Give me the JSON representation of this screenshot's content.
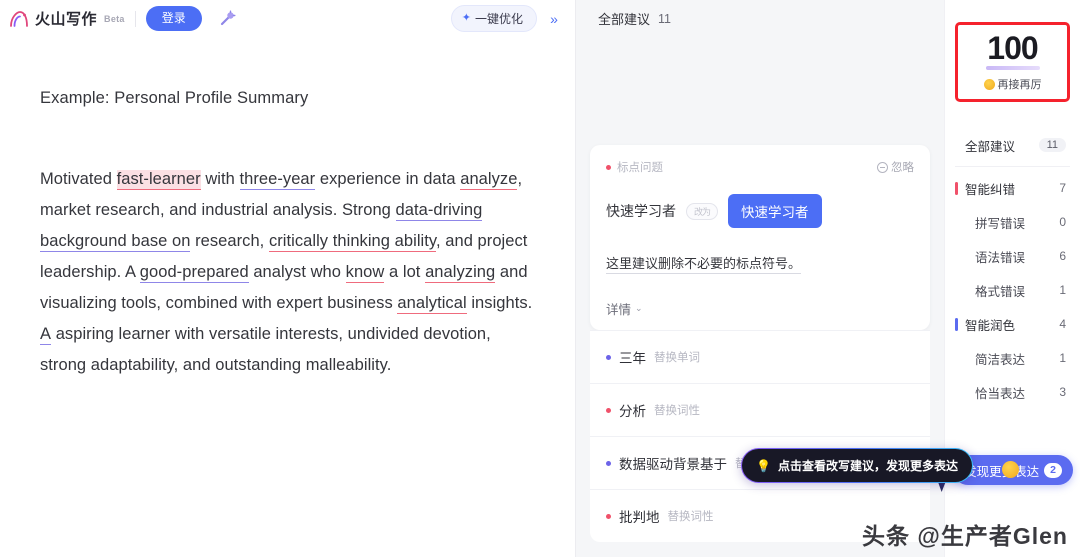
{
  "header": {
    "brand_name": "火山写作",
    "beta_tag": "Beta",
    "login_label": "登录",
    "magic_icon": "magic-wand-icon",
    "optimize_label": "一键优化",
    "sparkle_icon": "sparkle-icon",
    "collapse_icon": "»"
  },
  "document": {
    "title": "Example: Personal Profile Summary",
    "paragraph_segments": [
      {
        "text": "Motivated ",
        "style": "plain"
      },
      {
        "text": "fast-learner",
        "style": "highlight-red"
      },
      {
        "text": " with ",
        "style": "plain"
      },
      {
        "text": "three-year",
        "style": "underline-purple"
      },
      {
        "text": " experience in data ",
        "style": "plain"
      },
      {
        "text": "analyze",
        "style": "underline-red"
      },
      {
        "text": ", market research, and industrial analysis. Strong ",
        "style": "plain"
      },
      {
        "text": "data-driving background base on",
        "style": "underline-purple"
      },
      {
        "text": " research, ",
        "style": "plain"
      },
      {
        "text": "critically thinking ability",
        "style": "underline-red"
      },
      {
        "text": ", and project leadership. A ",
        "style": "plain"
      },
      {
        "text": "good-prepared",
        "style": "underline-purple"
      },
      {
        "text": " analyst who ",
        "style": "plain"
      },
      {
        "text": "know",
        "style": "underline-red"
      },
      {
        "text": " a lot ",
        "style": "plain"
      },
      {
        "text": "analyzing",
        "style": "underline-red"
      },
      {
        "text": " and visualizing tools, combined with expert business ",
        "style": "plain"
      },
      {
        "text": "analytical",
        "style": "underline-red"
      },
      {
        "text": " insights. ",
        "style": "plain"
      },
      {
        "text": "A",
        "style": "underline-purple"
      },
      {
        "text": " aspiring learner with versatile interests, undivided devotion, strong adaptability, and outstanding malleability.",
        "style": "plain"
      }
    ]
  },
  "suggestions": {
    "header_title": "全部建议",
    "header_count": "11",
    "card": {
      "tag": "标点问题",
      "tag_dot_color": "#f0516a",
      "ignore_label": "忽略",
      "ignore_icon": "circle-minus-icon",
      "old_word": "快速学习者",
      "arrow_chip": "改为",
      "new_word": "快速学习者",
      "description": "这里建议删除不必要的标点符号。",
      "detail_label": "详情",
      "detail_icon": "chevron-down-icon"
    },
    "rows": [
      {
        "word": "三年",
        "action": "替换单词",
        "dot_color": "#6c63e8"
      },
      {
        "word": "分析",
        "action": "替换词性",
        "dot_color": "#f0516a"
      },
      {
        "word": "数据驱动背景基于",
        "action": "替换词性",
        "dot_color": "#6c63e8"
      },
      {
        "word": "批判地",
        "action": "替换词性",
        "dot_color": "#f0516a"
      }
    ],
    "tooltip": {
      "icon": "lightbulb-icon",
      "text": "点击查看改写建议，发现更多表达"
    }
  },
  "stats": {
    "score": "100",
    "score_label": "再接再厉",
    "score_emoji": "smiley-icon",
    "all_label": "全部建议",
    "all_count": "11",
    "groups": [
      {
        "name": "智能纠错",
        "count": "7",
        "bar": "red",
        "sub": false
      },
      {
        "name": "拼写错误",
        "count": "0",
        "bar": "none",
        "sub": true
      },
      {
        "name": "语法错误",
        "count": "6",
        "bar": "none",
        "sub": true
      },
      {
        "name": "格式错误",
        "count": "1",
        "bar": "none",
        "sub": true
      },
      {
        "name": "智能润色",
        "count": "4",
        "bar": "purple",
        "sub": false
      },
      {
        "name": "简洁表达",
        "count": "1",
        "bar": "none",
        "sub": true
      },
      {
        "name": "恰当表达",
        "count": "3",
        "bar": "none",
        "sub": true
      }
    ],
    "discover_label": "发现更多表达",
    "discover_count": "2"
  },
  "watermark": "头条 @生产者Glen",
  "colors": {
    "accent_blue": "#4c6ef5",
    "error_red": "#f0516a",
    "polish_purple": "#5b6bf0",
    "highlight_box_red": "#f5222d"
  }
}
